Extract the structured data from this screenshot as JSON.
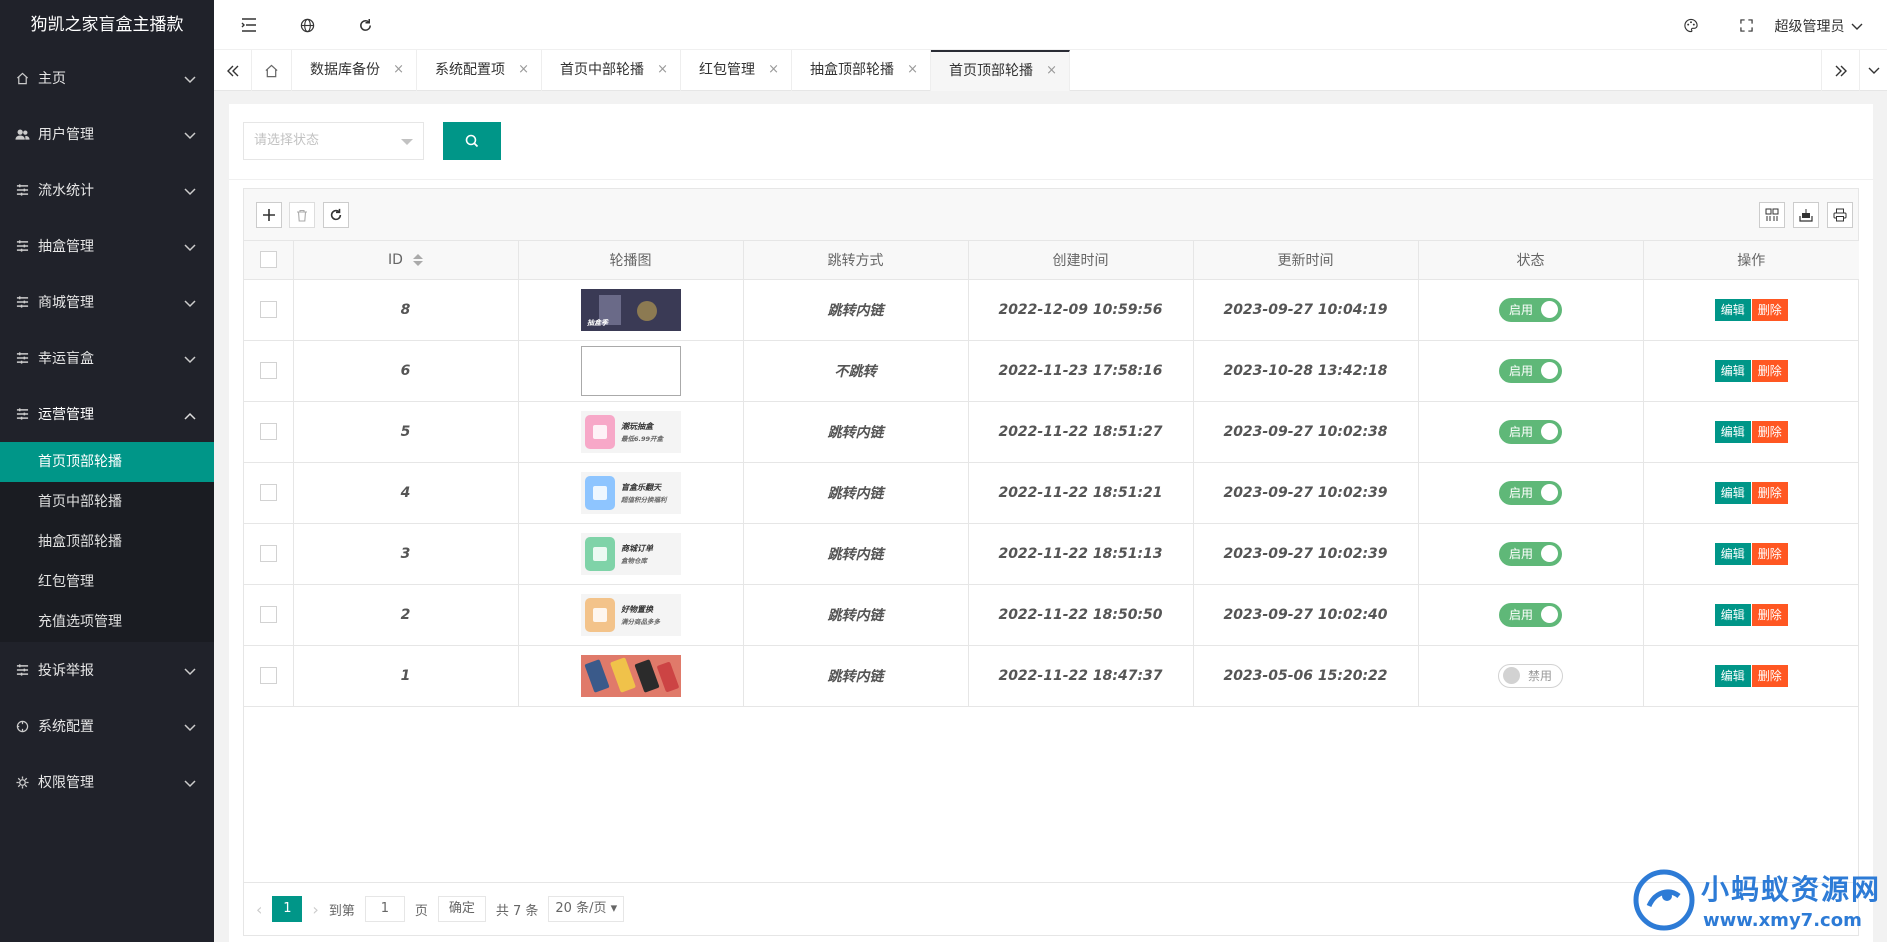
{
  "app_title": "狗凯之家盲盒主播款",
  "sidebar": {
    "items": [
      {
        "label": "主页",
        "icon": "home-icon"
      },
      {
        "label": "用户管理",
        "icon": "users-icon"
      },
      {
        "label": "流水统计",
        "icon": "list-icon"
      },
      {
        "label": "抽盒管理",
        "icon": "list-icon"
      },
      {
        "label": "商城管理",
        "icon": "list-icon"
      },
      {
        "label": "幸运盲盒",
        "icon": "list-icon"
      },
      {
        "label": "运营管理",
        "icon": "list-icon"
      },
      {
        "label": "投诉举报",
        "icon": "list-icon"
      },
      {
        "label": "系统配置",
        "icon": "settings-icon"
      },
      {
        "label": "权限管理",
        "icon": "gear-icon"
      }
    ],
    "sub_items": [
      {
        "label": "首页顶部轮播"
      },
      {
        "label": "首页中部轮播"
      },
      {
        "label": "抽盒顶部轮播"
      },
      {
        "label": "红包管理"
      },
      {
        "label": "充值选项管理"
      }
    ]
  },
  "header": {
    "user": "超级管理员"
  },
  "tabs": [
    {
      "label": "数据库备份"
    },
    {
      "label": "系统配置项"
    },
    {
      "label": "首页中部轮播"
    },
    {
      "label": "红包管理"
    },
    {
      "label": "抽盒顶部轮播"
    },
    {
      "label": "首页顶部轮播"
    }
  ],
  "search": {
    "placeholder": "请选择状态"
  },
  "table": {
    "headers": {
      "id": "ID",
      "image": "轮播图",
      "jump": "跳转方式",
      "created": "创建时间",
      "updated": "更新时间",
      "status": "状态",
      "ops": "操作"
    },
    "edit_label": "编辑",
    "delete_label": "删除",
    "rows": [
      {
        "id": "8",
        "jump": "跳转内链",
        "created": "2022-12-09 10:59:56",
        "updated": "2023-09-27 10:04:19",
        "status": "启用",
        "on": true,
        "thumb": {
          "title": "抽盒季",
          "sub": "",
          "color": "#3a3a55"
        }
      },
      {
        "id": "6",
        "jump": "不跳转",
        "created": "2022-11-23 17:58:16",
        "updated": "2023-10-28 13:42:18",
        "status": "启用",
        "on": true,
        "thumb": null
      },
      {
        "id": "5",
        "jump": "跳转内链",
        "created": "2022-11-22 18:51:27",
        "updated": "2023-09-27 10:02:38",
        "status": "启用",
        "on": true,
        "thumb": {
          "title": "潮玩抽盒",
          "sub": "最低6.99开盒",
          "color": "#f7a8c8"
        }
      },
      {
        "id": "4",
        "jump": "跳转内链",
        "created": "2022-11-22 18:51:21",
        "updated": "2023-09-27 10:02:39",
        "status": "启用",
        "on": true,
        "thumb": {
          "title": "盲盒乐翻天",
          "sub": "超值积分换福利",
          "color": "#8ec5ff"
        }
      },
      {
        "id": "3",
        "jump": "跳转内链",
        "created": "2022-11-22 18:51:13",
        "updated": "2023-09-27 10:02:39",
        "status": "启用",
        "on": true,
        "thumb": {
          "title": "商城订单",
          "sub": "盒物仓库",
          "color": "#7fd3a8"
        }
      },
      {
        "id": "2",
        "jump": "跳转内链",
        "created": "2022-11-22 18:50:50",
        "updated": "2023-09-27 10:02:40",
        "status": "启用",
        "on": true,
        "thumb": {
          "title": "好物置换",
          "sub": "满分商品多多",
          "color": "#f3c38a"
        }
      },
      {
        "id": "1",
        "jump": "跳转内链",
        "created": "2022-11-22 18:47:37",
        "updated": "2023-05-06 15:20:22",
        "status": "禁用",
        "on": false,
        "thumb": {
          "title": "",
          "sub": "",
          "color": "#e07a6a"
        }
      }
    ]
  },
  "pager": {
    "current": "1",
    "goto_label": "到第",
    "goto_value": "1",
    "page_label": "页",
    "ok_label": "确定",
    "total": "共 7 条",
    "size": "20 条/页"
  },
  "watermark": {
    "title": "小蚂蚁资源网",
    "url": "www.xmy7.com"
  },
  "colors": {
    "accent": "#009688",
    "sidebar": "#20222a",
    "danger": "#ff5722",
    "switch_on": "#5fb878"
  }
}
